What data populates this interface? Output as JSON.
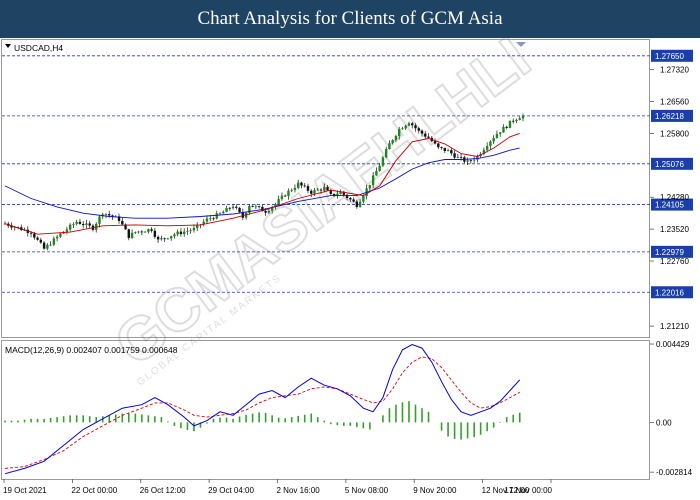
{
  "banner": {
    "title": "Chart Analysis for Clients of GCM Asia"
  },
  "symbol_label": "USDCAD,H4",
  "watermark": {
    "main": "GCMASIAEHLHLI",
    "sub": "GLOBAL CAPITAL MARKETS"
  },
  "colors": {
    "banner": "#1f4363",
    "level_box": "#1a3faa",
    "candle_up": "#1a8a1a",
    "candle_down": "#111111",
    "ma_fast": "#c00000",
    "ma_slow": "#1010cc",
    "macd_line": "#0000dd",
    "signal_line": "#dd0000",
    "histogram": "#33a02c"
  },
  "chart_data": [
    {
      "type": "candlestick",
      "name": "price",
      "ylim": [
        1.2095,
        1.2805
      ],
      "y_ticks": [
        "1.27320",
        "1.26560",
        "1.25800",
        "1.24280",
        "1.23520",
        "1.22760",
        "1.21210"
      ],
      "levels": [
        "1.27650",
        "1.26218",
        "1.25076",
        "1.24105",
        "1.22979",
        "1.22016"
      ],
      "x_labels": [
        "19 Oct 2021",
        "22 Oct 00:00",
        "26 Oct 12:00",
        "29 Oct 04:00",
        "2 Nov 16:00",
        "5 Nov 08:00",
        "9 Nov 20:00",
        "12 Nov 12:00",
        "17 Nov 00:00"
      ],
      "close_path": [
        [
          0,
          1.2365
        ],
        [
          8,
          1.2345
        ],
        [
          12,
          1.2305
        ],
        [
          17,
          1.234
        ],
        [
          22,
          1.237
        ],
        [
          27,
          1.2355
        ],
        [
          30,
          1.2392
        ],
        [
          35,
          1.2375
        ],
        [
          38,
          1.2335
        ],
        [
          40,
          1.2345
        ],
        [
          45,
          1.2352
        ],
        [
          47,
          1.2325
        ],
        [
          52,
          1.234
        ],
        [
          58,
          1.2352
        ],
        [
          62,
          1.2375
        ],
        [
          66,
          1.2388
        ],
        [
          70,
          1.2408
        ],
        [
          73,
          1.238
        ],
        [
          75,
          1.241
        ],
        [
          80,
          1.2395
        ],
        [
          83,
          1.2412
        ],
        [
          86,
          1.2435
        ],
        [
          90,
          1.246
        ],
        [
          94,
          1.244
        ],
        [
          98,
          1.245
        ],
        [
          100,
          1.2432
        ],
        [
          103,
          1.244
        ],
        [
          106,
          1.2422
        ],
        [
          108,
          1.241
        ],
        [
          112,
          1.246
        ],
        [
          115,
          1.2505
        ],
        [
          118,
          1.2555
        ],
        [
          121,
          1.259
        ],
        [
          124,
          1.2608
        ],
        [
          127,
          1.2585
        ],
        [
          130,
          1.257
        ],
        [
          133,
          1.2545
        ],
        [
          136,
          1.2538
        ],
        [
          139,
          1.2522
        ],
        [
          142,
          1.2512
        ],
        [
          145,
          1.2525
        ],
        [
          148,
          1.2555
        ],
        [
          151,
          1.258
        ],
        [
          154,
          1.2598
        ],
        [
          156,
          1.2612
        ],
        [
          158,
          1.262
        ]
      ],
      "ma_fast": [
        [
          0,
          1.2365
        ],
        [
          10,
          1.234
        ],
        [
          20,
          1.2345
        ],
        [
          30,
          1.236
        ],
        [
          40,
          1.2362
        ],
        [
          50,
          1.236
        ],
        [
          60,
          1.2362
        ],
        [
          70,
          1.2378
        ],
        [
          80,
          1.2398
        ],
        [
          90,
          1.2425
        ],
        [
          100,
          1.2445
        ],
        [
          110,
          1.2432
        ],
        [
          115,
          1.2455
        ],
        [
          120,
          1.2515
        ],
        [
          125,
          1.256
        ],
        [
          130,
          1.2568
        ],
        [
          135,
          1.2555
        ],
        [
          140,
          1.2532
        ],
        [
          145,
          1.2525
        ],
        [
          150,
          1.2545
        ],
        [
          155,
          1.2572
        ],
        [
          158,
          1.258
        ]
      ],
      "ma_slow": [
        [
          0,
          1.2455
        ],
        [
          8,
          1.2425
        ],
        [
          16,
          1.2405
        ],
        [
          24,
          1.239
        ],
        [
          32,
          1.2382
        ],
        [
          40,
          1.2378
        ],
        [
          50,
          1.2378
        ],
        [
          60,
          1.2382
        ],
        [
          70,
          1.2388
        ],
        [
          80,
          1.24
        ],
        [
          90,
          1.2418
        ],
        [
          100,
          1.2432
        ],
        [
          108,
          1.2432
        ],
        [
          115,
          1.245
        ],
        [
          120,
          1.2472
        ],
        [
          125,
          1.2495
        ],
        [
          130,
          1.251
        ],
        [
          135,
          1.2518
        ],
        [
          140,
          1.2518
        ],
        [
          145,
          1.252
        ],
        [
          150,
          1.2528
        ],
        [
          155,
          1.254
        ],
        [
          158,
          1.2545
        ]
      ]
    },
    {
      "type": "macd",
      "title": "MACD(12,26,9) 0.002407 0.001759 0.000648",
      "params": "12,26,9",
      "values": {
        "macd": 0.002407,
        "signal": 0.001759,
        "histogram": 0.000648
      },
      "ylim": [
        -0.0032,
        0.0046
      ],
      "y_ticks": [
        "0.004429",
        "0.00",
        "-0.002814"
      ],
      "macd_line": [
        [
          0,
          -0.0029
        ],
        [
          6,
          -0.0026
        ],
        [
          12,
          -0.0022
        ],
        [
          18,
          -0.0013
        ],
        [
          24,
          -0.0004
        ],
        [
          30,
          0.0002
        ],
        [
          36,
          0.0008
        ],
        [
          42,
          0.001
        ],
        [
          46,
          0.0014
        ],
        [
          50,
          0.001
        ],
        [
          55,
          0.0003
        ],
        [
          58,
          -0.0002
        ],
        [
          62,
          0.0001
        ],
        [
          66,
          0.0006
        ],
        [
          70,
          0.0004
        ],
        [
          74,
          0.001
        ],
        [
          78,
          0.0016
        ],
        [
          82,
          0.0018
        ],
        [
          86,
          0.0014
        ],
        [
          90,
          0.002
        ],
        [
          94,
          0.0025
        ],
        [
          98,
          0.0021
        ],
        [
          102,
          0.0019
        ],
        [
          106,
          0.0015
        ],
        [
          110,
          0.0008
        ],
        [
          113,
          0.0006
        ],
        [
          116,
          0.0014
        ],
        [
          119,
          0.003
        ],
        [
          122,
          0.0041
        ],
        [
          125,
          0.0044
        ],
        [
          128,
          0.0042
        ],
        [
          131,
          0.0034
        ],
        [
          134,
          0.0023
        ],
        [
          137,
          0.0013
        ],
        [
          140,
          0.0006
        ],
        [
          143,
          0.0004
        ],
        [
          146,
          0.0006
        ],
        [
          149,
          0.0008
        ],
        [
          152,
          0.0012
        ],
        [
          155,
          0.0018
        ],
        [
          158,
          0.0024
        ]
      ],
      "signal_line": [
        [
          0,
          -0.0026
        ],
        [
          6,
          -0.0025
        ],
        [
          12,
          -0.0021
        ],
        [
          18,
          -0.0016
        ],
        [
          24,
          -0.0008
        ],
        [
          30,
          -0.0002
        ],
        [
          36,
          0.0004
        ],
        [
          42,
          0.0008
        ],
        [
          46,
          0.0011
        ],
        [
          50,
          0.0011
        ],
        [
          55,
          0.0007
        ],
        [
          58,
          0.0004
        ],
        [
          62,
          0.0003
        ],
        [
          66,
          0.0004
        ],
        [
          70,
          0.0005
        ],
        [
          74,
          0.0007
        ],
        [
          78,
          0.0011
        ],
        [
          82,
          0.0014
        ],
        [
          86,
          0.0015
        ],
        [
          90,
          0.0016
        ],
        [
          94,
          0.0019
        ],
        [
          98,
          0.002
        ],
        [
          102,
          0.0019
        ],
        [
          106,
          0.0016
        ],
        [
          110,
          0.0013
        ],
        [
          113,
          0.0011
        ],
        [
          116,
          0.0012
        ],
        [
          119,
          0.0019
        ],
        [
          122,
          0.0028
        ],
        [
          125,
          0.0034
        ],
        [
          128,
          0.0037
        ],
        [
          131,
          0.0036
        ],
        [
          134,
          0.0031
        ],
        [
          137,
          0.0024
        ],
        [
          140,
          0.0017
        ],
        [
          143,
          0.0011
        ],
        [
          146,
          0.0008
        ],
        [
          149,
          0.0009
        ],
        [
          152,
          0.0011
        ],
        [
          155,
          0.0014
        ],
        [
          158,
          0.0017
        ]
      ],
      "histogram": [
        [
          0,
          0.0001
        ],
        [
          4,
          0.0001
        ],
        [
          8,
          0.0002
        ],
        [
          12,
          0.0002
        ],
        [
          16,
          0.0003
        ],
        [
          20,
          0.0004
        ],
        [
          24,
          0.0004
        ],
        [
          28,
          0.0003
        ],
        [
          32,
          0.0004
        ],
        [
          36,
          0.0005
        ],
        [
          40,
          0.0005
        ],
        [
          44,
          0.0004
        ],
        [
          48,
          0.0003
        ],
        [
          52,
          -0.0002
        ],
        [
          55,
          -0.0004
        ],
        [
          58,
          -0.0005
        ],
        [
          61,
          -0.0002
        ],
        [
          64,
          0.0002
        ],
        [
          67,
          0.0003
        ],
        [
          70,
          0.0002
        ],
        [
          73,
          0.0004
        ],
        [
          76,
          0.0005
        ],
        [
          79,
          0.0006
        ],
        [
          82,
          0.0004
        ],
        [
          85,
          0.0002
        ],
        [
          88,
          0.0003
        ],
        [
          91,
          0.0004
        ],
        [
          94,
          0.0005
        ],
        [
          97,
          0.0002
        ],
        [
          100,
          -0.0001
        ],
        [
          103,
          -0.0002
        ],
        [
          106,
          -0.0002
        ],
        [
          109,
          -0.0003
        ],
        [
          112,
          -0.0004
        ],
        [
          115,
          0.0002
        ],
        [
          118,
          0.0008
        ],
        [
          121,
          0.0011
        ],
        [
          124,
          0.0012
        ],
        [
          127,
          0.0009
        ],
        [
          130,
          0.0006
        ],
        [
          133,
          -0.0003
        ],
        [
          136,
          -0.0008
        ],
        [
          139,
          -0.001
        ],
        [
          142,
          -0.0009
        ],
        [
          145,
          -0.0008
        ],
        [
          148,
          -0.0005
        ],
        [
          151,
          -0.0002
        ],
        [
          154,
          0.0003
        ],
        [
          157,
          0.0005
        ],
        [
          159,
          0.0006
        ]
      ]
    }
  ]
}
